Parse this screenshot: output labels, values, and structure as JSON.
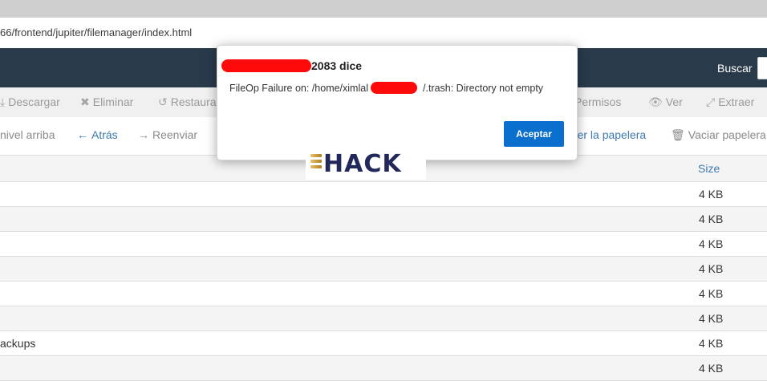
{
  "browser": {
    "address": "66/frontend/jupiter/filemanager/index.html"
  },
  "topbar": {
    "search_label": "Buscar",
    "search_value": ""
  },
  "toolbar": {
    "items": [
      {
        "label": "Descargar",
        "icon": "download-icon"
      },
      {
        "label": "Eliminar",
        "icon": "close-icon"
      },
      {
        "label": "Restaura",
        "icon": "undo-icon"
      },
      {
        "label": "Permisos",
        "icon": "key-icon"
      },
      {
        "label": "Ver",
        "icon": "eye-icon"
      },
      {
        "label": "Extraer",
        "icon": "expand-icon"
      }
    ]
  },
  "navbar": {
    "up": "nivel arriba",
    "back": "Atrás",
    "forward": "Reenviar",
    "view_trash": "Ver la papelera",
    "empty_trash": "Vaciar papelera"
  },
  "table": {
    "size_header": "Size",
    "rows": [
      {
        "name": "",
        "size": "4 KB"
      },
      {
        "name": "",
        "size": "4 KB"
      },
      {
        "name": "",
        "size": "4 KB"
      },
      {
        "name": "",
        "size": "4 KB"
      },
      {
        "name": "",
        "size": "4 KB"
      },
      {
        "name": "",
        "size": "4 KB"
      },
      {
        "name": "ackups",
        "size": "4 KB"
      },
      {
        "name": "",
        "size": "4 KB"
      }
    ]
  },
  "dialog": {
    "title_suffix": "2083 dice",
    "message_start": "FileOp Failure on: /home/ximlal",
    "message_end": "/.trash: Directory not empty",
    "ok_label": "Aceptar"
  },
  "watermark": {
    "text": "HACK"
  },
  "colors": {
    "topbar": "#293a4a",
    "accent": "#0b6fce",
    "redaction": "#ff0a0a",
    "link": "#3f79b3"
  }
}
